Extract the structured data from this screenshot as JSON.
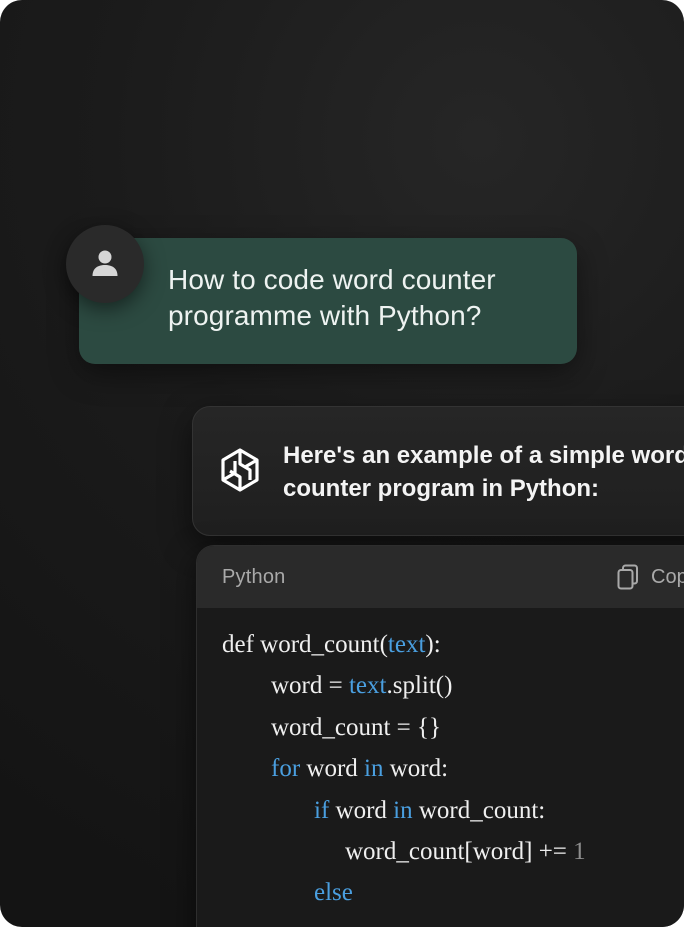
{
  "user_message": {
    "line1": "How to code word counter",
    "line2": "programme with Python?",
    "avatar_icon": "user-icon"
  },
  "assistant_message": {
    "line1": "Here's an example of a simple word",
    "line2": "counter program in Python:",
    "logo_icon": "hexagon-logo-icon"
  },
  "code_block": {
    "language": "Python",
    "copy_label": "Copy",
    "copy_icon": "copy-icon",
    "lines": [
      {
        "indent": 0,
        "tokens": [
          {
            "t": "def word_count("
          },
          {
            "t": "text",
            "k": "kw"
          },
          {
            "t": "):"
          }
        ]
      },
      {
        "indent": 1,
        "tokens": [
          {
            "t": "word = "
          },
          {
            "t": "text",
            "k": "kw"
          },
          {
            "t": ".split()"
          }
        ]
      },
      {
        "indent": 1,
        "tokens": [
          {
            "t": "word_count = {}"
          }
        ]
      },
      {
        "indent": 1,
        "tokens": [
          {
            "t": "for",
            "k": "kw"
          },
          {
            "t": " word "
          },
          {
            "t": "in",
            "k": "kw"
          },
          {
            "t": " word:"
          }
        ]
      },
      {
        "indent": 2,
        "tokens": [
          {
            "t": "if",
            "k": "kw"
          },
          {
            "t": " word "
          },
          {
            "t": "in",
            "k": "kw"
          },
          {
            "t": " word_count:"
          }
        ]
      },
      {
        "indent": 3,
        "tokens": [
          {
            "t": "word_count[word] += "
          },
          {
            "t": "1",
            "k": "num"
          }
        ]
      },
      {
        "indent": 2,
        "tokens": [
          {
            "t": "else",
            "k": "kw"
          }
        ]
      }
    ]
  },
  "colors": {
    "background": "#1b1b1b",
    "user_bubble": "#2c4a41",
    "keyword": "#4a9fe0",
    "number": "#8d8d8d"
  }
}
